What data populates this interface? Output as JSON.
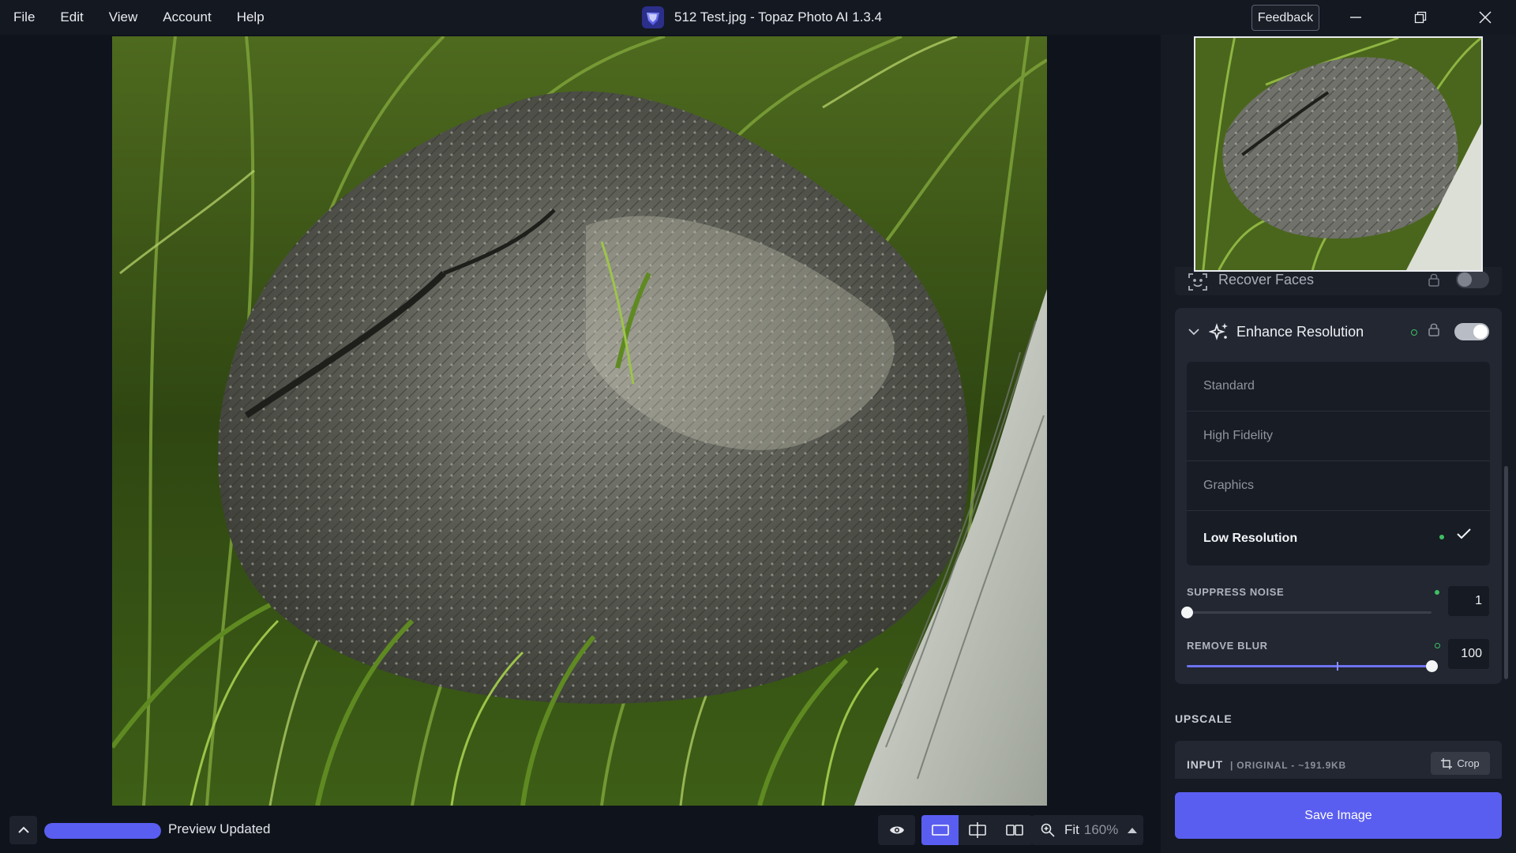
{
  "menu": {
    "items": [
      "File",
      "Edit",
      "View",
      "Account",
      "Help"
    ]
  },
  "window": {
    "title": "512 Test.jpg - Topaz Photo AI 1.3.4",
    "feedback_label": "Feedback",
    "controls": [
      "minimize-icon",
      "restore-icon",
      "close-icon"
    ]
  },
  "recover_faces": {
    "label": "Recover Faces",
    "enabled": false
  },
  "enhance_resolution": {
    "title": "Enhance Resolution",
    "enabled": true,
    "models": [
      {
        "label": "Standard",
        "selected": false
      },
      {
        "label": "High Fidelity",
        "selected": false
      },
      {
        "label": "Graphics",
        "selected": false
      },
      {
        "label": "Low Resolution",
        "selected": true
      }
    ],
    "suppress_noise": {
      "label": "SUPPRESS NOISE",
      "value": "1",
      "fraction": 0.0
    },
    "remove_blur": {
      "label": "REMOVE BLUR",
      "value": "100",
      "fraction": 1.0
    }
  },
  "upscale": {
    "section_label": "UPSCALE",
    "input_label": "INPUT",
    "input_meta": "| ORIGINAL - ~191.9KB",
    "crop_label": "Crop"
  },
  "save_label": "Save Image",
  "status": {
    "progress_fraction": 1.0,
    "text": "Preview Updated"
  },
  "zoom": {
    "fit_label": "Fit",
    "percent": "160%"
  },
  "colors": {
    "accent": "#5a5ef0",
    "status_green": "#3fbf63",
    "panel_bg": "#161a23",
    "app_bg": "#0f131c"
  }
}
